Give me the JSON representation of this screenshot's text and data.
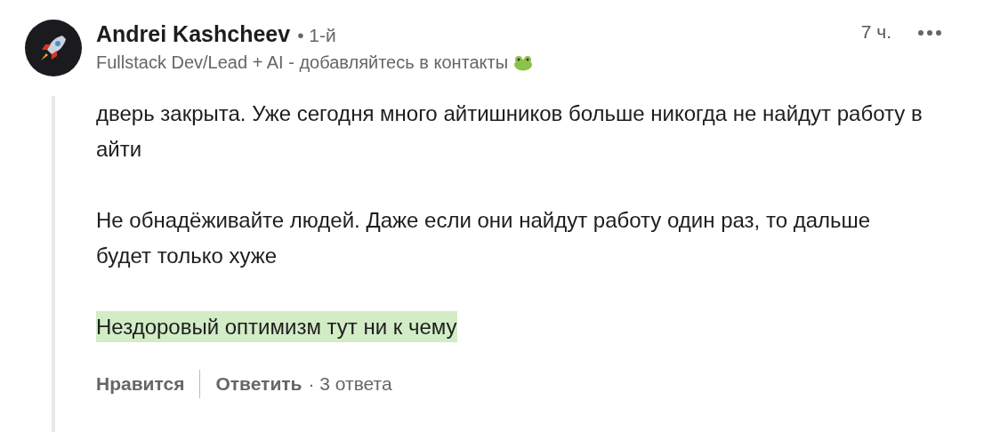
{
  "comment": {
    "author": "Andrei Kashcheev",
    "degree": "• 1-й",
    "headline": "Fullstack Dev/Lead + AI - добавляйтесь в контакты",
    "time": "7 ч.",
    "paragraphs": [
      {
        "text": "дверь закрыта. Уже сегодня много айтишников больше никогда не найдут работу в айти",
        "highlighted": false
      },
      {
        "text": "Не обнадёживайте людей. Даже если они найдут работу один раз, то дальше будет только хуже",
        "highlighted": false
      },
      {
        "text": "Нездоровый оптимизм тут ни к чему",
        "highlighted": true
      }
    ],
    "actions": {
      "like": "Нравится",
      "reply": "Ответить",
      "replies": "· 3 ответа"
    }
  }
}
